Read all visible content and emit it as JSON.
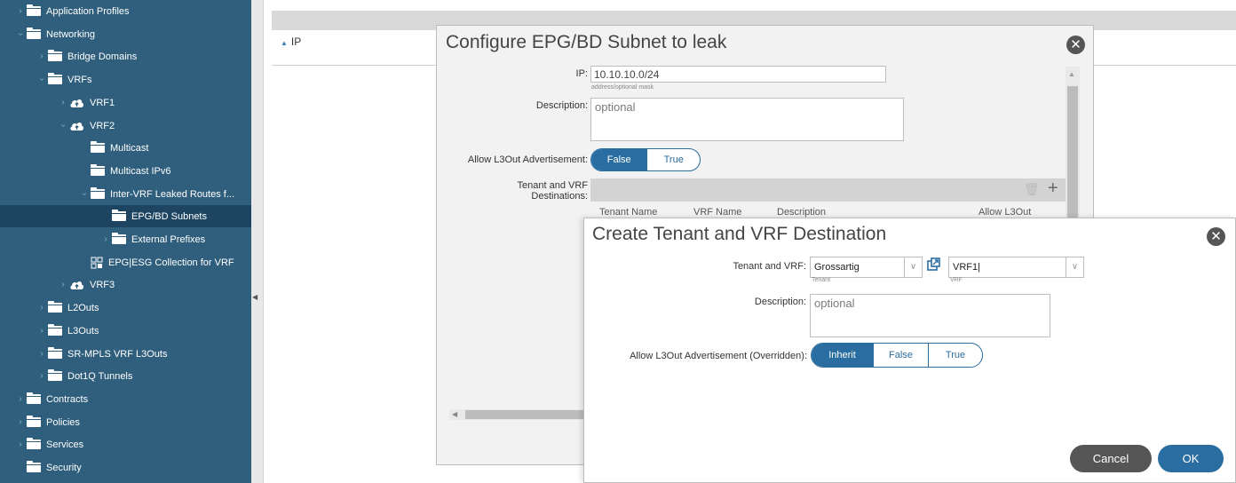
{
  "sidebar": {
    "items": [
      {
        "label": "Application Profiles",
        "level": 1,
        "chevron": "right",
        "icon": "folder-icon"
      },
      {
        "label": "Networking",
        "level": 1,
        "chevron": "down",
        "icon": "folder-icon"
      },
      {
        "label": "Bridge Domains",
        "level": 2,
        "chevron": "right",
        "icon": "folder-icon"
      },
      {
        "label": "VRFs",
        "level": 2,
        "chevron": "down",
        "icon": "folder-icon"
      },
      {
        "label": "VRF1",
        "level": 3,
        "chevron": "right",
        "icon": "cloud-icon"
      },
      {
        "label": "VRF2",
        "level": 3,
        "chevron": "down",
        "icon": "cloud-icon"
      },
      {
        "label": "Multicast",
        "level": 4,
        "chevron": "none",
        "icon": "folder-icon"
      },
      {
        "label": "Multicast IPv6",
        "level": 4,
        "chevron": "none",
        "icon": "folder-icon"
      },
      {
        "label": "Inter-VRF Leaked Routes f...",
        "level": 4,
        "chevron": "down",
        "icon": "folder-icon"
      },
      {
        "label": "EPG/BD Subnets",
        "level": 5,
        "chevron": "none",
        "icon": "folder-icon",
        "selected": true
      },
      {
        "label": "External Prefixes",
        "level": 5,
        "chevron": "right",
        "icon": "folder-icon"
      },
      {
        "label": "EPG|ESG Collection for VRF",
        "level": 4,
        "chevron": "none",
        "icon": "grid-icon"
      },
      {
        "label": "VRF3",
        "level": 3,
        "chevron": "right",
        "icon": "cloud-icon"
      },
      {
        "label": "L2Outs",
        "level": 2,
        "chevron": "right",
        "icon": "folder-icon"
      },
      {
        "label": "L3Outs",
        "level": 2,
        "chevron": "right",
        "icon": "folder-icon"
      },
      {
        "label": "SR-MPLS VRF L3Outs",
        "level": 2,
        "chevron": "right",
        "icon": "folder-icon"
      },
      {
        "label": "Dot1Q Tunnels",
        "level": 2,
        "chevron": "right",
        "icon": "folder-icon"
      },
      {
        "label": "Contracts",
        "level": 1,
        "chevron": "right",
        "icon": "folder-icon"
      },
      {
        "label": "Policies",
        "level": 1,
        "chevron": "right",
        "icon": "folder-icon"
      },
      {
        "label": "Services",
        "level": 1,
        "chevron": "right",
        "icon": "folder-icon"
      },
      {
        "label": "Security",
        "level": 1,
        "chevron": "none",
        "icon": "folder-icon"
      }
    ]
  },
  "background": {
    "ip_section_label": "IP"
  },
  "dialog1": {
    "title": "Configure EPG/BD Subnet to leak",
    "ip_label": "IP:",
    "ip_value": "10.10.10.0/24",
    "ip_hint": "address/optional mask",
    "description_label": "Description:",
    "description_placeholder": "optional",
    "allow_l3out_label": "Allow L3Out Advertisement:",
    "allow_l3out_options": [
      "False",
      "True"
    ],
    "allow_l3out_selected": "False",
    "destinations_label_line1": "Tenant and VRF",
    "destinations_label_line2": "Destinations:",
    "columns": [
      "Tenant Name",
      "VRF Name",
      "Description",
      "Allow L3Out"
    ]
  },
  "dialog2": {
    "title": "Create Tenant and VRF Destination",
    "tenant_vrf_label": "Tenant and VRF:",
    "tenant_value": "Grossartig",
    "tenant_hint": "Tenant",
    "vrf_value": "VRF1|",
    "vrf_hint": "VRF",
    "description_label": "Description:",
    "description_placeholder": "optional",
    "allow_l3out_label": "Allow L3Out Advertisement (Overridden):",
    "allow_l3out_options": [
      "Inherit",
      "False",
      "True"
    ],
    "allow_l3out_selected": "Inherit",
    "cancel_label": "Cancel",
    "ok_label": "OK"
  },
  "colors": {
    "sidebar_bg": "#2f5f7d",
    "sidebar_selected": "#1d4561",
    "accent": "#2a6da0",
    "cancel_bg": "#555555"
  }
}
